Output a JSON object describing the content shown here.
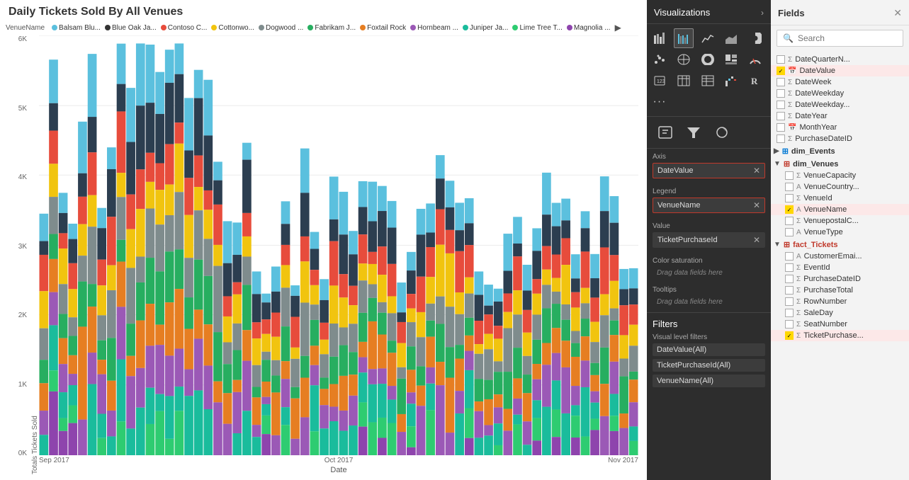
{
  "chart": {
    "title": "Daily Tickets Sold By All Venues",
    "yAxisLabel": "Totals Tickets Sold",
    "xAxisLabel": "Date",
    "yAxisValues": [
      "6K",
      "5K",
      "4K",
      "3K",
      "2K",
      "1K",
      "0K"
    ],
    "xAxisValues": [
      "Sep 2017",
      "Oct 2017",
      "Nov 2017"
    ],
    "legendTitle": "VenueName",
    "legendItems": [
      {
        "label": "Balsam Blu...",
        "color": "#5bc0de"
      },
      {
        "label": "Blue Oak Ja...",
        "color": "#333"
      },
      {
        "label": "Contoso C...",
        "color": "#e74c3c"
      },
      {
        "label": "Cottonwo...",
        "color": "#f1c40f"
      },
      {
        "label": "Dogwood ...",
        "color": "#7f8c8d"
      },
      {
        "label": "Fabrikam J...",
        "color": "#27ae60"
      },
      {
        "label": "Foxtail Rock",
        "color": "#e67e22"
      },
      {
        "label": "Hornbeam ...",
        "color": "#9b59b6"
      },
      {
        "label": "Juniper Ja...",
        "color": "#1abc9c"
      },
      {
        "label": "Lime Tree T...",
        "color": "#2ecc71"
      },
      {
        "label": "Magnolia ...",
        "color": "#8e44ad"
      }
    ]
  },
  "visualizations": {
    "header": "Visualizations",
    "expandArrow": "›",
    "sections": {
      "axis": {
        "label": "Axis",
        "value": "DateValue",
        "highlighted": true
      },
      "legend": {
        "label": "Legend",
        "value": "VenueName",
        "highlighted": true
      },
      "value": {
        "label": "Value",
        "value": "TicketPurchaseId",
        "highlighted": false
      },
      "colorSaturation": {
        "label": "Color saturation",
        "placeholder": "Drag data fields here"
      },
      "tooltips": {
        "label": "Tooltips",
        "placeholder": "Drag data fields here"
      }
    },
    "filters": {
      "title": "Filters",
      "visualLabel": "Visual level filters",
      "items": [
        "DateValue(All)",
        "TicketPurchaseId(All)",
        "VenueName(All)"
      ]
    }
  },
  "fields": {
    "header": "Fields",
    "closeBtn": "✕",
    "searchPlaceholder": "Search",
    "items": [
      {
        "type": "field",
        "name": "DateQuarterN...",
        "checked": false,
        "icon": "Σ",
        "indent": 0
      },
      {
        "type": "field",
        "name": "DateValue",
        "checked": true,
        "icon": "📅",
        "indent": 0,
        "highlighted": true
      },
      {
        "type": "field",
        "name": "DateWeek",
        "checked": false,
        "icon": "Σ",
        "indent": 0
      },
      {
        "type": "field",
        "name": "DateWeekday",
        "checked": false,
        "icon": "Σ",
        "indent": 0
      },
      {
        "type": "field",
        "name": "DateWeekday...",
        "checked": false,
        "icon": "Σ",
        "indent": 0
      },
      {
        "type": "field",
        "name": "DateYear",
        "checked": false,
        "icon": "Σ",
        "indent": 0
      },
      {
        "type": "field",
        "name": "MonthYear",
        "checked": false,
        "icon": "📅",
        "indent": 0
      },
      {
        "type": "field",
        "name": "PurchaseDateID",
        "checked": false,
        "icon": "Σ",
        "indent": 0
      },
      {
        "type": "group",
        "name": "dim_Events",
        "expanded": false,
        "indent": 0
      },
      {
        "type": "group",
        "name": "dim_Venues",
        "expanded": true,
        "indent": 0
      },
      {
        "type": "field",
        "name": "VenueCapacity",
        "checked": false,
        "icon": "Σ",
        "indent": 1
      },
      {
        "type": "field",
        "name": "VenueCountry...",
        "checked": false,
        "icon": "A",
        "indent": 1
      },
      {
        "type": "field",
        "name": "VenueId",
        "checked": false,
        "icon": "Σ",
        "indent": 1
      },
      {
        "type": "field",
        "name": "VenueName",
        "checked": true,
        "icon": "A",
        "indent": 1,
        "highlighted": true
      },
      {
        "type": "field",
        "name": "VenuepostalC...",
        "checked": false,
        "icon": "Σ",
        "indent": 1
      },
      {
        "type": "field",
        "name": "VenueType",
        "checked": false,
        "icon": "A",
        "indent": 1
      },
      {
        "type": "group",
        "name": "fact_Tickets",
        "expanded": true,
        "indent": 0,
        "color": "#c0392b"
      },
      {
        "type": "field",
        "name": "CustomerEmai...",
        "checked": false,
        "icon": "A",
        "indent": 1
      },
      {
        "type": "field",
        "name": "EventId",
        "checked": false,
        "icon": "Σ",
        "indent": 1
      },
      {
        "type": "field",
        "name": "PurchaseDateID",
        "checked": false,
        "icon": "Σ",
        "indent": 1
      },
      {
        "type": "field",
        "name": "PurchaseTotal",
        "checked": false,
        "icon": "Σ",
        "indent": 1
      },
      {
        "type": "field",
        "name": "RowNumber",
        "checked": false,
        "icon": "Σ",
        "indent": 1
      },
      {
        "type": "field",
        "name": "SaleDay",
        "checked": false,
        "icon": "Σ",
        "indent": 1
      },
      {
        "type": "field",
        "name": "SeatNumber",
        "checked": false,
        "icon": "Σ",
        "indent": 1
      },
      {
        "type": "field",
        "name": "TicketPurchase...",
        "checked": true,
        "icon": "Σ",
        "indent": 1,
        "highlighted": true
      }
    ]
  },
  "colors": {
    "vizBg": "#2d2d2d",
    "fieldsBg": "#f3f3f3",
    "accent": "#c0392b",
    "checkboxChecked": "#ffd700"
  }
}
